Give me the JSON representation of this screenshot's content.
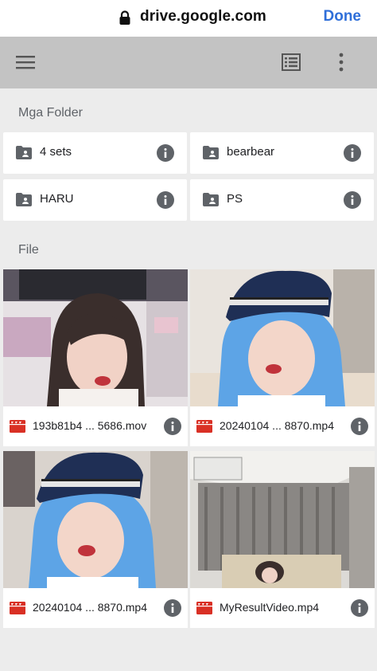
{
  "browser": {
    "url": "drive.google.com",
    "done_label": "Done"
  },
  "sections": {
    "folders_label": "Mga Folder",
    "files_label": "File"
  },
  "folders": [
    {
      "name": "4 sets"
    },
    {
      "name": "bearbear"
    },
    {
      "name": "HARU"
    },
    {
      "name": "PS"
    }
  ],
  "files": [
    {
      "name": "193b81b4 ... 5686.mov"
    },
    {
      "name": "20240104 ... 8870.mp4"
    },
    {
      "name": "20240104 ... 8870.mp4"
    },
    {
      "name": "MyResultVideo.mp4"
    }
  ],
  "colors": {
    "accent": "#2f6fd9",
    "video_icon": "#d93025",
    "toolbar_bg": "#c3c3c3",
    "page_bg": "#ececec"
  },
  "icons": {
    "lock": "lock-icon",
    "menu": "hamburger-menu-icon",
    "list_view": "list-view-icon",
    "more": "more-vert-icon",
    "folder": "shared-folder-icon",
    "info": "info-icon",
    "video": "video-file-icon"
  }
}
